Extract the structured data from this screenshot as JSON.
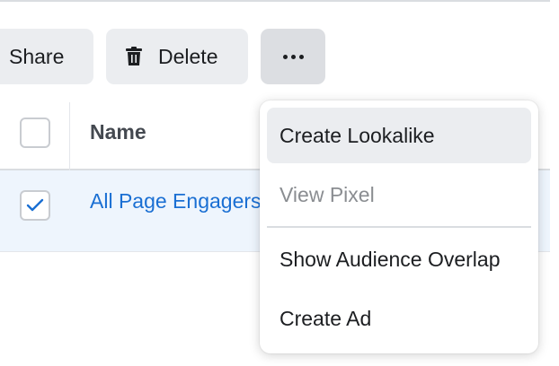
{
  "toolbar": {
    "share_label": "Share",
    "delete_label": "Delete",
    "delete_icon": "trash-icon",
    "more_icon": "more-horizontal-icon"
  },
  "table": {
    "columns": [
      "Name"
    ],
    "rows": [
      {
        "name": "All Page Engagers",
        "checked": true
      }
    ]
  },
  "menu": {
    "items": [
      {
        "label": "Create Lookalike",
        "state": "hover"
      },
      {
        "label": "View Pixel",
        "state": "disabled"
      },
      {
        "label": "Show Audience Overlap",
        "state": "normal"
      },
      {
        "label": "Create Ad",
        "state": "normal"
      }
    ]
  },
  "colors": {
    "link": "#1a6fd3",
    "row_selected_bg": "#eef5fd",
    "button_bg": "#ebedf0",
    "disabled_text": "#8a8d91"
  }
}
